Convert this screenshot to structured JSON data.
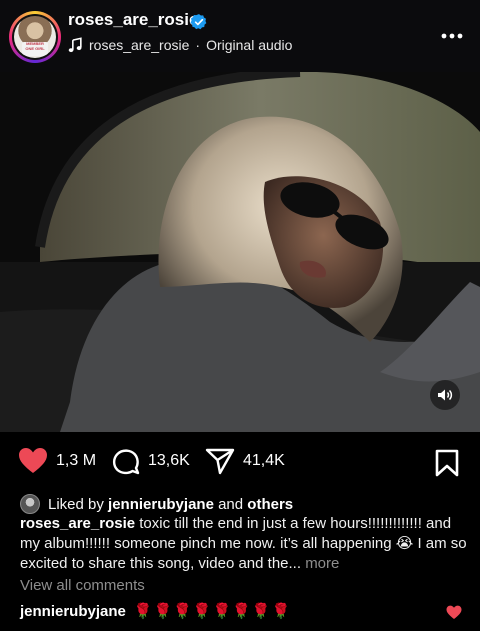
{
  "header": {
    "avatar_text": "MEMBER ONE GIRL",
    "username": "roses_are_rosie",
    "audio_user": "roses_are_rosie",
    "audio_separator": "·",
    "audio_label": "Original audio"
  },
  "actions": {
    "likes": "1,3 M",
    "comments": "13,6K",
    "shares": "41,4K"
  },
  "liked_by": {
    "prefix": "Liked by",
    "user": "jennierubyjane",
    "middle": "and",
    "others": "others"
  },
  "caption": {
    "user": "roses_are_rosie",
    "text": "toxic till the end in just a few hours!!!!!!!!!!!!! and my album!!!!!! someone pinch me now. it’s all happening 😭 I am so excited to share this song, video and the...",
    "more": "more"
  },
  "view_comments": "View all comments",
  "comment": {
    "user": "jennierubyjane",
    "text": "🌹🌹🌹🌹🌹🌹🌹🌹"
  },
  "colors": {
    "like": "#ed4956",
    "verified": "#1d9bf0",
    "muted": "#8e8e8e"
  },
  "icons": [
    "verified-badge-icon",
    "music-note-icon",
    "more-options-icon",
    "volume-icon",
    "heart-icon",
    "comment-icon",
    "share-icon",
    "bookmark-icon"
  ]
}
